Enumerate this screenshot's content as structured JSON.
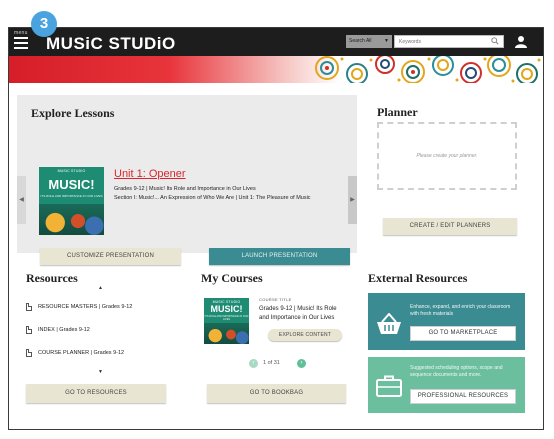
{
  "badge": "3",
  "header": {
    "menu_label": "menu",
    "brand": "MUSiC STUDiO",
    "search_scope": "Search All",
    "search_placeholder": "Keywords"
  },
  "explore": {
    "title": "Explore Lessons",
    "unit_title": "Unit 1: Opener",
    "line1": "Grades 9-12 | Music! Its Role and Importance in Our Lives",
    "line2": "Section I: Music!... An Expression of Who We Are | Unit 1: The Pleasure of Music",
    "customize_button": "CUSTOMIZE PRESENTATION",
    "launch_button": "LAUNCH PRESENTATION",
    "cover": {
      "top": "MUSIC STUDIO",
      "title": "MUSIC!",
      "sub": "ITS ROLE AND IMPORTANCE IN OUR LIVES"
    }
  },
  "planner": {
    "title": "Planner",
    "empty_text": "Please create your planner.",
    "button": "CREATE / EDIT PLANNERS"
  },
  "resources": {
    "title": "Resources",
    "items": [
      "RESOURCE MASTERS | Grades 9-12",
      "INDEX | Grades 9-12",
      "COURSE PLANNER | Grades 9-12"
    ],
    "button": "GO TO RESOURCES"
  },
  "courses": {
    "title": "My Courses",
    "course_label": "COURSE TITLE",
    "course_line1": "Grades 9-12 | Music! Its Role",
    "course_line2": "and Importance in Our Lives",
    "explore_button": "EXPLORE CONTENT",
    "pager_text": "1 of 31",
    "button": "GO TO BOOKBAG",
    "cover": {
      "top": "MUSIC STUDIO",
      "title": "MUSIC!",
      "sub": "ITS ROLE AND IMPORTANCE IN OUR LIVES"
    }
  },
  "external": {
    "title": "External Resources",
    "card1_text": "Enhance, expand, and enrich your classroom with fresh materials",
    "card1_button": "GO TO MARKETPLACE",
    "card2_text": "Suggested scheduling options, scope and sequence documents and more.",
    "card2_button": "PROFESSIONAL RESOURCES"
  },
  "colors": {
    "topbar": "#1d1d1d",
    "accent_red": "#d8262d",
    "badge_blue": "#4aa3df",
    "teal": "#3b8b92",
    "mint": "#6bbf9f"
  }
}
